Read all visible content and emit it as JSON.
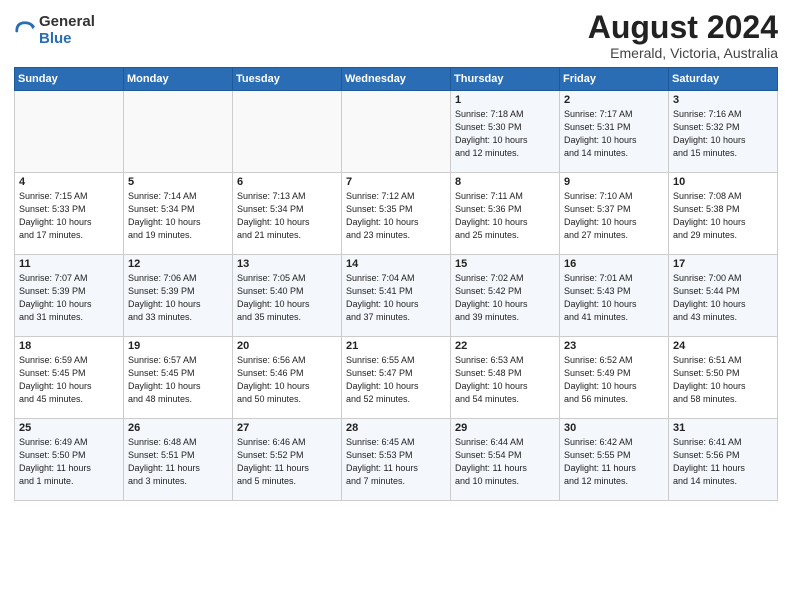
{
  "header": {
    "logo_general": "General",
    "logo_blue": "Blue",
    "title": "August 2024",
    "subtitle": "Emerald, Victoria, Australia"
  },
  "days_of_week": [
    "Sunday",
    "Monday",
    "Tuesday",
    "Wednesday",
    "Thursday",
    "Friday",
    "Saturday"
  ],
  "weeks": [
    [
      {
        "day": "",
        "info": ""
      },
      {
        "day": "",
        "info": ""
      },
      {
        "day": "",
        "info": ""
      },
      {
        "day": "",
        "info": ""
      },
      {
        "day": "1",
        "info": "Sunrise: 7:18 AM\nSunset: 5:30 PM\nDaylight: 10 hours\nand 12 minutes."
      },
      {
        "day": "2",
        "info": "Sunrise: 7:17 AM\nSunset: 5:31 PM\nDaylight: 10 hours\nand 14 minutes."
      },
      {
        "day": "3",
        "info": "Sunrise: 7:16 AM\nSunset: 5:32 PM\nDaylight: 10 hours\nand 15 minutes."
      }
    ],
    [
      {
        "day": "4",
        "info": "Sunrise: 7:15 AM\nSunset: 5:33 PM\nDaylight: 10 hours\nand 17 minutes."
      },
      {
        "day": "5",
        "info": "Sunrise: 7:14 AM\nSunset: 5:34 PM\nDaylight: 10 hours\nand 19 minutes."
      },
      {
        "day": "6",
        "info": "Sunrise: 7:13 AM\nSunset: 5:34 PM\nDaylight: 10 hours\nand 21 minutes."
      },
      {
        "day": "7",
        "info": "Sunrise: 7:12 AM\nSunset: 5:35 PM\nDaylight: 10 hours\nand 23 minutes."
      },
      {
        "day": "8",
        "info": "Sunrise: 7:11 AM\nSunset: 5:36 PM\nDaylight: 10 hours\nand 25 minutes."
      },
      {
        "day": "9",
        "info": "Sunrise: 7:10 AM\nSunset: 5:37 PM\nDaylight: 10 hours\nand 27 minutes."
      },
      {
        "day": "10",
        "info": "Sunrise: 7:08 AM\nSunset: 5:38 PM\nDaylight: 10 hours\nand 29 minutes."
      }
    ],
    [
      {
        "day": "11",
        "info": "Sunrise: 7:07 AM\nSunset: 5:39 PM\nDaylight: 10 hours\nand 31 minutes."
      },
      {
        "day": "12",
        "info": "Sunrise: 7:06 AM\nSunset: 5:39 PM\nDaylight: 10 hours\nand 33 minutes."
      },
      {
        "day": "13",
        "info": "Sunrise: 7:05 AM\nSunset: 5:40 PM\nDaylight: 10 hours\nand 35 minutes."
      },
      {
        "day": "14",
        "info": "Sunrise: 7:04 AM\nSunset: 5:41 PM\nDaylight: 10 hours\nand 37 minutes."
      },
      {
        "day": "15",
        "info": "Sunrise: 7:02 AM\nSunset: 5:42 PM\nDaylight: 10 hours\nand 39 minutes."
      },
      {
        "day": "16",
        "info": "Sunrise: 7:01 AM\nSunset: 5:43 PM\nDaylight: 10 hours\nand 41 minutes."
      },
      {
        "day": "17",
        "info": "Sunrise: 7:00 AM\nSunset: 5:44 PM\nDaylight: 10 hours\nand 43 minutes."
      }
    ],
    [
      {
        "day": "18",
        "info": "Sunrise: 6:59 AM\nSunset: 5:45 PM\nDaylight: 10 hours\nand 45 minutes."
      },
      {
        "day": "19",
        "info": "Sunrise: 6:57 AM\nSunset: 5:45 PM\nDaylight: 10 hours\nand 48 minutes."
      },
      {
        "day": "20",
        "info": "Sunrise: 6:56 AM\nSunset: 5:46 PM\nDaylight: 10 hours\nand 50 minutes."
      },
      {
        "day": "21",
        "info": "Sunrise: 6:55 AM\nSunset: 5:47 PM\nDaylight: 10 hours\nand 52 minutes."
      },
      {
        "day": "22",
        "info": "Sunrise: 6:53 AM\nSunset: 5:48 PM\nDaylight: 10 hours\nand 54 minutes."
      },
      {
        "day": "23",
        "info": "Sunrise: 6:52 AM\nSunset: 5:49 PM\nDaylight: 10 hours\nand 56 minutes."
      },
      {
        "day": "24",
        "info": "Sunrise: 6:51 AM\nSunset: 5:50 PM\nDaylight: 10 hours\nand 58 minutes."
      }
    ],
    [
      {
        "day": "25",
        "info": "Sunrise: 6:49 AM\nSunset: 5:50 PM\nDaylight: 11 hours\nand 1 minute."
      },
      {
        "day": "26",
        "info": "Sunrise: 6:48 AM\nSunset: 5:51 PM\nDaylight: 11 hours\nand 3 minutes."
      },
      {
        "day": "27",
        "info": "Sunrise: 6:46 AM\nSunset: 5:52 PM\nDaylight: 11 hours\nand 5 minutes."
      },
      {
        "day": "28",
        "info": "Sunrise: 6:45 AM\nSunset: 5:53 PM\nDaylight: 11 hours\nand 7 minutes."
      },
      {
        "day": "29",
        "info": "Sunrise: 6:44 AM\nSunset: 5:54 PM\nDaylight: 11 hours\nand 10 minutes."
      },
      {
        "day": "30",
        "info": "Sunrise: 6:42 AM\nSunset: 5:55 PM\nDaylight: 11 hours\nand 12 minutes."
      },
      {
        "day": "31",
        "info": "Sunrise: 6:41 AM\nSunset: 5:56 PM\nDaylight: 11 hours\nand 14 minutes."
      }
    ]
  ]
}
